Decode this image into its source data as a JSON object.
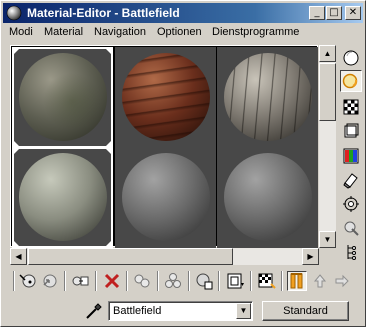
{
  "window": {
    "title": "Material-Editor - Battlefield",
    "minimize_glyph": "_",
    "maximize_glyph": "□",
    "close_glyph": "✕"
  },
  "menu": [
    {
      "label": "Modi"
    },
    {
      "label": "Material"
    },
    {
      "label": "Navigation"
    },
    {
      "label": "Optionen"
    },
    {
      "label": "Dienstprogramme"
    }
  ],
  "sample_slots": [
    {
      "material": "mossy-stone",
      "colors": [
        "#9a9888",
        "#5e5f52",
        "#26281f"
      ],
      "active": true
    },
    {
      "material": "rusty-metal-bands",
      "colors": [
        "#b06a48",
        "#6a2e1c",
        "#1e0c06"
      ],
      "active": false
    },
    {
      "material": "old-wood-planks",
      "colors": [
        "#c9c4b9",
        "#7c776f",
        "#25231f"
      ],
      "active": false
    },
    {
      "material": "pale-stone",
      "colors": [
        "#c6c9bb",
        "#8a8d80",
        "#2b2c26"
      ],
      "active": true
    },
    {
      "material": "default-gray",
      "colors": [
        "#a2a2a2",
        "#6a6a6a",
        "#2a2a2a"
      ],
      "active": false
    },
    {
      "material": "default-gray",
      "colors": [
        "#a2a2a2",
        "#6a6a6a",
        "#2a2a2a"
      ],
      "active": false
    }
  ],
  "side_tools": [
    {
      "name": "sample-type-sphere-icon",
      "active": false
    },
    {
      "name": "backlight-icon",
      "active": true
    },
    {
      "name": "background-checker-icon",
      "active": false
    },
    {
      "name": "sample-uv-tiling-icon",
      "active": false
    },
    {
      "name": "video-color-check-icon",
      "active": false
    },
    {
      "name": "make-preview-icon",
      "active": false
    },
    {
      "name": "options-icon",
      "active": false
    },
    {
      "name": "select-by-material-icon",
      "active": false
    },
    {
      "name": "material-map-navigator-icon",
      "active": false
    }
  ],
  "bottom_tools": [
    {
      "name": "get-material-icon",
      "active": false
    },
    {
      "name": "put-material-to-scene-icon",
      "active": false
    },
    {
      "name": "assign-material-to-selection-icon",
      "active": false
    },
    {
      "name": "reset-map-icon",
      "active": false
    },
    {
      "name": "make-material-copy-icon",
      "active": false
    },
    {
      "name": "make-unique-icon",
      "active": false
    },
    {
      "name": "put-to-library-icon",
      "active": false
    },
    {
      "name": "material-effects-channel-icon",
      "active": false
    },
    {
      "name": "show-map-in-viewport-icon",
      "active": false
    },
    {
      "name": "show-end-result-icon",
      "active": true
    },
    {
      "name": "go-to-parent-icon",
      "active": false
    },
    {
      "name": "go-forward-to-sibling-icon",
      "active": false
    }
  ],
  "material_name": "Battlefield",
  "material_type": "Standard",
  "colors": {
    "title_start": "#0a246a",
    "title_end": "#a6caf0",
    "face": "#d4d0c8",
    "accent_orange": "#f0a020",
    "delete_red": "#c02020"
  }
}
